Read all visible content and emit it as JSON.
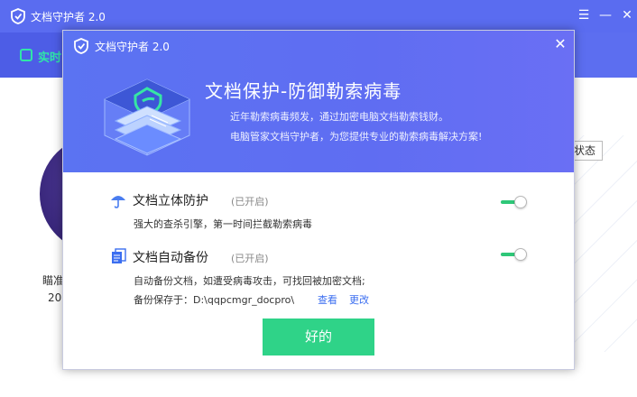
{
  "app": {
    "title": "文档守护者 2.0",
    "nav_active_label": "实时",
    "status_button": "状态",
    "partial_text_1": "瞄准",
    "partial_text_2": "20",
    "window_controls": [
      "menu-icon",
      "minimize-icon",
      "close-icon"
    ]
  },
  "dialog": {
    "title": "文档守护者 2.0",
    "close_icon": "close-icon",
    "heading": "文档保护-防御勒索病毒",
    "desc_line1": "近年勒索病毒频发，通过加密电脑文档勒索钱财。",
    "desc_line2": "电脑管家文档守护者，为您提供专业的勒索病毒解决方案!",
    "features": [
      {
        "icon": "umbrella-icon",
        "title": "文档立体防护",
        "status": "(已开启)",
        "desc": "强大的查杀引擎，第一时间拦截勒索病毒",
        "enabled": true
      },
      {
        "icon": "documents-icon",
        "title": "文档自动备份",
        "status": "(已开启)",
        "desc": "自动备份文档，如遭受病毒攻击，可找回被加密文档;",
        "path_label": "备份保存于：D:\\qqpcmgr_docpro\\",
        "link_view": "查看",
        "link_change": "更改",
        "enabled": true
      }
    ],
    "ok_button": "好的"
  },
  "colors": {
    "accent": "#5a6cf0",
    "toggle_on": "#2ec778",
    "ok_button": "#2fd388",
    "link": "#3b6ef0",
    "nav_active": "#30e6a8"
  }
}
